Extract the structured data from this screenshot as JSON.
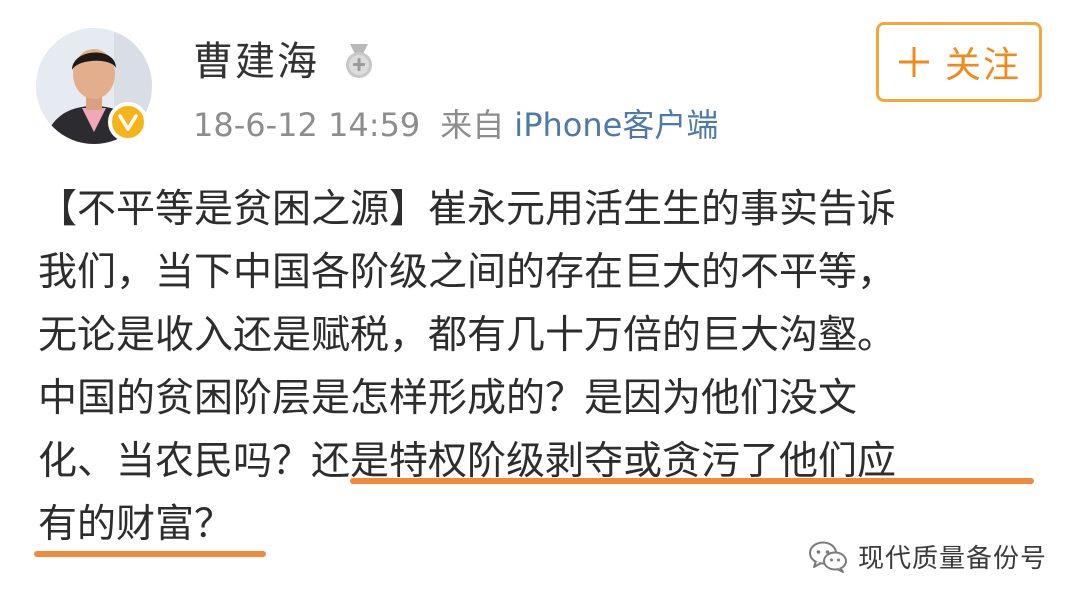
{
  "post": {
    "author": "曹建海",
    "timestamp": "18-6-12 14:59",
    "source_prefix": "来自",
    "source": "iPhone客户端",
    "body_lines": [
      "【不平等是贫困之源】崔永元用活生生的事实告诉",
      "我们，当下中国各阶级之间的存在巨大的不平等，",
      "无论是收入还是赋税，都有几十万倍的巨大沟壑。",
      "中国的贫困阶层是怎样形成的？是因为他们没文",
      "化、当农民吗？还是特权阶级剥夺或贪污了他们应",
      "有的财富？"
    ]
  },
  "follow_button": {
    "label": "关注",
    "icon": "plus-icon"
  },
  "watermark": {
    "text": "现代质量备份号",
    "icon": "wechat-icon"
  },
  "icons": {
    "medal": "medal-icon",
    "verified": "verified-badge-icon"
  },
  "colors": {
    "accent_orange": "#f08a1c",
    "underline": "#f08a3c",
    "link_blue": "#4f79a6",
    "verified_gold": "#f6b41b",
    "meta_gray": "#8d8d8d"
  }
}
